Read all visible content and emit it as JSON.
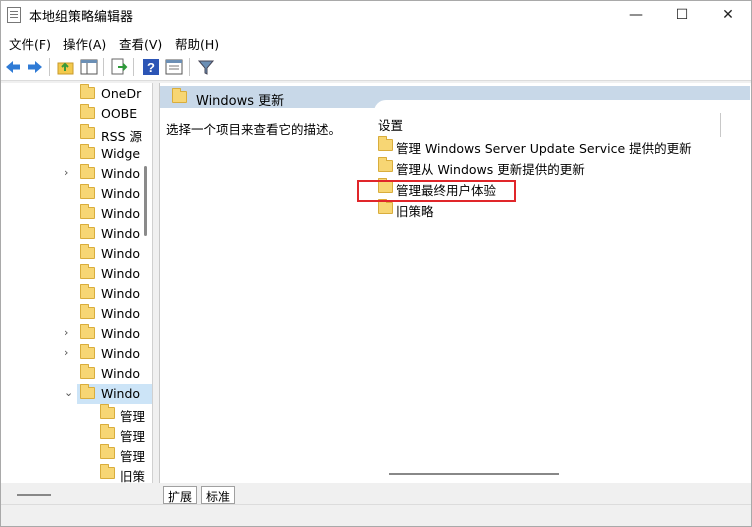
{
  "window": {
    "title": "本地组策略编辑器",
    "minimize": "—",
    "maximize": "☐",
    "close": "✕"
  },
  "menu": {
    "file": "文件(F)",
    "action": "操作(A)",
    "view": "查看(V)",
    "help": "帮助(H)"
  },
  "toolbar": {
    "icons": [
      "back-arrow-icon",
      "forward-arrow-icon",
      "up-folder-icon",
      "show-hide-tree-icon",
      "export-list-icon",
      "help-icon",
      "properties-icon",
      "filter-icon"
    ],
    "accent": "#2f7bd6"
  },
  "tree": {
    "items": [
      {
        "label": "OneDr",
        "expandable": false
      },
      {
        "label": "OOBE",
        "expandable": false
      },
      {
        "label": "RSS 源",
        "expandable": false
      },
      {
        "label": "Widge",
        "expandable": false
      },
      {
        "label": "Windo",
        "expandable": true
      },
      {
        "label": "Windo",
        "expandable": false
      },
      {
        "label": "Windo",
        "expandable": false
      },
      {
        "label": "Windo",
        "expandable": false
      },
      {
        "label": "Windo",
        "expandable": false
      },
      {
        "label": "Windo",
        "expandable": false
      },
      {
        "label": "Windo",
        "expandable": false
      },
      {
        "label": "Windo",
        "expandable": false
      },
      {
        "label": "Windo",
        "expandable": true
      },
      {
        "label": "Windo",
        "expandable": true
      },
      {
        "label": "Windo",
        "expandable": false
      },
      {
        "label": "Windo",
        "expandable": "open",
        "selected": true
      }
    ],
    "children": [
      "管理",
      "管理",
      "管理",
      "旧策"
    ]
  },
  "right": {
    "header_title": "Windows 更新",
    "description": "选择一个项目来查看它的描述。",
    "column_header": "设置",
    "items": [
      "管理 Windows Server Update Service 提供的更新",
      "管理从 Windows 更新提供的更新",
      "管理最终用户体验",
      "旧策略"
    ],
    "highlight_color": "#e0262a"
  },
  "tabs": {
    "extended": "扩展",
    "standard": "标准"
  }
}
